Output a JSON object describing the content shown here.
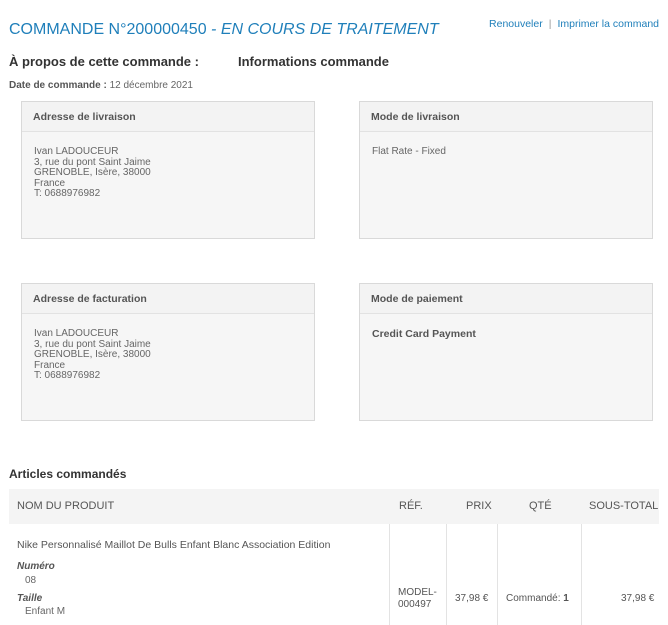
{
  "header": {
    "order_number": "COMMANDE N°200000450",
    "status": " - EN COURS DE TRAITEMENT",
    "reorder_label": "Renouveler",
    "separator": "|",
    "print_label": "Imprimer la command"
  },
  "about": {
    "label": "À propos de cette commande :",
    "info_label": "Informations commande",
    "date_label": "Date de commande :",
    "date_value": " 12 décembre 2021"
  },
  "shipping_address": {
    "title": "Adresse de livraison",
    "lines": [
      "Ivan LADOUCEUR",
      "3, rue du pont Saint Jaime",
      "GRENOBLE, Isère, 38000",
      "France",
      "T: 0688976982"
    ]
  },
  "shipping_method": {
    "title": "Mode de livraison",
    "value": "Flat Rate - Fixed"
  },
  "billing_address": {
    "title": "Adresse de facturation",
    "lines": [
      "Ivan LADOUCEUR",
      "3, rue du pont Saint Jaime",
      "GRENOBLE, Isère, 38000",
      "France",
      "T: 0688976982"
    ]
  },
  "payment_method": {
    "title": "Mode de paiement",
    "value": "Credit Card Payment"
  },
  "items": {
    "title": "Articles commandés",
    "columns": {
      "name": "NOM DU PRODUIT",
      "ref": "RÉF.",
      "price": "PRIX",
      "qty": "QTÉ",
      "subtotal": "SOUS-TOTAL"
    },
    "rows": [
      {
        "name": "Nike Personnalisé Maillot De Bulls Enfant Blanc Association Edition",
        "options": [
          {
            "label": "Numéro",
            "value": "08"
          },
          {
            "label": "Taille",
            "value": "Enfant M"
          }
        ],
        "ref_line1": "MODEL-",
        "ref_line2": "000497",
        "price": "37,98 €",
        "qty_label": "Commandé: ",
        "qty_value": "1",
        "subtotal": "37,98 €"
      }
    ]
  }
}
